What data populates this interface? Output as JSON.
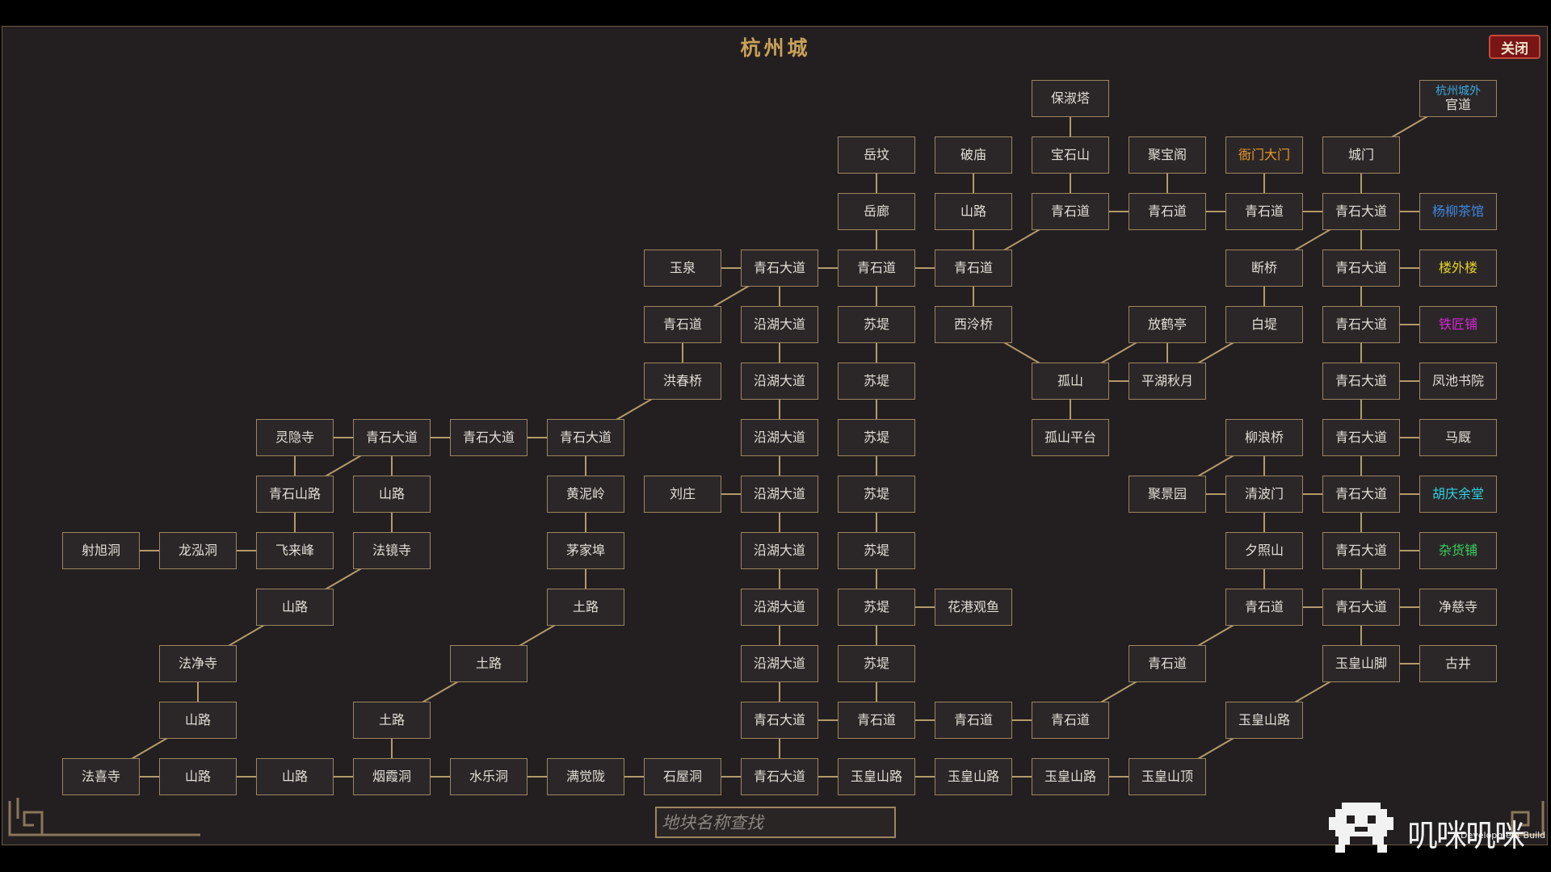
{
  "title": "杭州城",
  "close_label": "关闭",
  "search": {
    "placeholder": "地块名称查找"
  },
  "watermark": {
    "text": "叽咪叽咪",
    "build_label": "Development Build"
  },
  "colors": {
    "default": "#e2ddd5",
    "orange": "#e89a2a",
    "blue": "#3e86e0",
    "yellow": "#e3d12a",
    "magenta": "#d628d6",
    "cyan": "#2fd0e0",
    "green": "#3ad15e",
    "sky": "#3aa8e0"
  },
  "nodes": [
    {
      "id": "baoshuta",
      "label": "保淑塔"
    },
    {
      "id": "hzcw",
      "sub": "杭州城外",
      "label": "官道"
    },
    {
      "id": "yuefen",
      "label": "岳坟"
    },
    {
      "id": "pomiao",
      "label": "破庙"
    },
    {
      "id": "baoshishan",
      "label": "宝石山"
    },
    {
      "id": "jubaoge",
      "label": "聚宝阁"
    },
    {
      "id": "yamendamen",
      "label": "衙门大门",
      "color": "orange"
    },
    {
      "id": "chengmen",
      "label": "城门"
    },
    {
      "id": "yuelang",
      "label": "岳廊"
    },
    {
      "id": "shanlu_a",
      "label": "山路"
    },
    {
      "id": "qsd_a",
      "label": "青石道"
    },
    {
      "id": "qsd_b",
      "label": "青石道"
    },
    {
      "id": "qsd_c",
      "label": "青石道"
    },
    {
      "id": "qsdd_a",
      "label": "青石大道"
    },
    {
      "id": "yangliu",
      "label": "杨柳茶馆",
      "color": "blue"
    },
    {
      "id": "yuquan",
      "label": "玉泉"
    },
    {
      "id": "qsdd_b",
      "label": "青石大道"
    },
    {
      "id": "qsd_d",
      "label": "青石道"
    },
    {
      "id": "qsd_e",
      "label": "青石道"
    },
    {
      "id": "duanqiao",
      "label": "断桥"
    },
    {
      "id": "qsdd_c",
      "label": "青石大道"
    },
    {
      "id": "louwailou",
      "label": "楼外楼",
      "color": "yellow"
    },
    {
      "id": "qsd_f",
      "label": "青石道"
    },
    {
      "id": "yhdd_a",
      "label": "沿湖大道"
    },
    {
      "id": "sudi_a",
      "label": "苏堤"
    },
    {
      "id": "xilingqiao",
      "label": "西泠桥"
    },
    {
      "id": "fanghe",
      "label": "放鹤亭"
    },
    {
      "id": "baidi",
      "label": "白堤"
    },
    {
      "id": "qsdd_d",
      "label": "青石大道"
    },
    {
      "id": "tiejiang",
      "label": "铁匠铺",
      "color": "magenta"
    },
    {
      "id": "hongchun",
      "label": "洪春桥"
    },
    {
      "id": "yhdd_b",
      "label": "沿湖大道"
    },
    {
      "id": "sudi_b",
      "label": "苏堤"
    },
    {
      "id": "gushan",
      "label": "孤山"
    },
    {
      "id": "pinghu",
      "label": "平湖秋月"
    },
    {
      "id": "qsdd_e",
      "label": "青石大道"
    },
    {
      "id": "fengchi",
      "label": "凤池书院"
    },
    {
      "id": "lingyin",
      "label": "灵隐寺"
    },
    {
      "id": "qsdd_f",
      "label": "青石大道"
    },
    {
      "id": "qsdd_g",
      "label": "青石大道"
    },
    {
      "id": "qsdd_h",
      "label": "青石大道"
    },
    {
      "id": "yhdd_c",
      "label": "沿湖大道"
    },
    {
      "id": "sudi_c",
      "label": "苏堤"
    },
    {
      "id": "gushanpt",
      "label": "孤山平台"
    },
    {
      "id": "liulang",
      "label": "柳浪桥"
    },
    {
      "id": "qsdd_i",
      "label": "青石大道"
    },
    {
      "id": "majiu",
      "label": "马厩"
    },
    {
      "id": "qssl",
      "label": "青石山路"
    },
    {
      "id": "shanlu_b",
      "label": "山路"
    },
    {
      "id": "huangniling",
      "label": "黄泥岭"
    },
    {
      "id": "liuzhuang",
      "label": "刘庄"
    },
    {
      "id": "yhdd_d",
      "label": "沿湖大道"
    },
    {
      "id": "sudi_d",
      "label": "苏堤"
    },
    {
      "id": "jujingyuan",
      "label": "聚景园"
    },
    {
      "id": "qingbomen",
      "label": "清波门"
    },
    {
      "id": "qsdd_j",
      "label": "青石大道"
    },
    {
      "id": "huqingyu",
      "label": "胡庆余堂",
      "color": "cyan"
    },
    {
      "id": "shexu",
      "label": "射旭洞"
    },
    {
      "id": "longhong",
      "label": "龙泓洞"
    },
    {
      "id": "feilai",
      "label": "飞来峰"
    },
    {
      "id": "fajing",
      "label": "法镜寺"
    },
    {
      "id": "maojiabu",
      "label": "茅家埠"
    },
    {
      "id": "yhdd_e",
      "label": "沿湖大道"
    },
    {
      "id": "sudi_e",
      "label": "苏堤"
    },
    {
      "id": "xizhao",
      "label": "夕照山"
    },
    {
      "id": "qsdd_k",
      "label": "青石大道"
    },
    {
      "id": "zahuo",
      "label": "杂货铺",
      "color": "green"
    },
    {
      "id": "shanlu_c",
      "label": "山路"
    },
    {
      "id": "tulu_a",
      "label": "土路"
    },
    {
      "id": "yhdd_f",
      "label": "沿湖大道"
    },
    {
      "id": "sudi_f",
      "label": "苏堤"
    },
    {
      "id": "huagang",
      "label": "花港观鱼"
    },
    {
      "id": "qsd_g",
      "label": "青石道"
    },
    {
      "id": "qsdd_l",
      "label": "青石大道"
    },
    {
      "id": "jingci",
      "label": "净慈寺"
    },
    {
      "id": "fajingsi2",
      "label": "法净寺"
    },
    {
      "id": "tulu_b",
      "label": "土路"
    },
    {
      "id": "yhdd_g",
      "label": "沿湖大道"
    },
    {
      "id": "sudi_g",
      "label": "苏堤"
    },
    {
      "id": "qsd_h",
      "label": "青石道"
    },
    {
      "id": "yhsj",
      "label": "玉皇山脚"
    },
    {
      "id": "gujing",
      "label": "古井"
    },
    {
      "id": "shanlu_d",
      "label": "山路"
    },
    {
      "id": "tulu_c",
      "label": "土路"
    },
    {
      "id": "qsdd_m",
      "label": "青石大道"
    },
    {
      "id": "qsd_i",
      "label": "青石道"
    },
    {
      "id": "qsd_j",
      "label": "青石道"
    },
    {
      "id": "qsd_k",
      "label": "青石道"
    },
    {
      "id": "yhsl_a",
      "label": "玉皇山路"
    },
    {
      "id": "faxi",
      "label": "法喜寺"
    },
    {
      "id": "shanlu_e",
      "label": "山路"
    },
    {
      "id": "shanlu_f",
      "label": "山路"
    },
    {
      "id": "yanxia",
      "label": "烟霞洞"
    },
    {
      "id": "shuile",
      "label": "水乐洞"
    },
    {
      "id": "manjue",
      "label": "满觉陇"
    },
    {
      "id": "shiwu",
      "label": "石屋洞"
    },
    {
      "id": "qsdd_n",
      "label": "青石大道"
    },
    {
      "id": "yhsl_b",
      "label": "玉皇山路"
    },
    {
      "id": "yhsl_c",
      "label": "玉皇山路"
    },
    {
      "id": "yhsl_d",
      "label": "玉皇山路"
    },
    {
      "id": "yhsd",
      "label": "玉皇山顶"
    }
  ],
  "edges": [
    [
      "baoshuta",
      "baoshishan"
    ],
    [
      "hzcw",
      "chengmen"
    ],
    [
      "yuefen",
      "yuelang"
    ],
    [
      "pomiao",
      "shanlu_a"
    ],
    [
      "baoshishan",
      "qsd_a"
    ],
    [
      "jubaoge",
      "qsd_b"
    ],
    [
      "yamendamen",
      "qsd_c"
    ],
    [
      "chengmen",
      "qsdd_a"
    ],
    [
      "qsd_a",
      "qsd_b"
    ],
    [
      "qsd_b",
      "qsd_c"
    ],
    [
      "qsd_c",
      "qsdd_a"
    ],
    [
      "qsdd_a",
      "yangliu"
    ],
    [
      "yuelang",
      "qsd_d"
    ],
    [
      "shanlu_a",
      "qsd_e"
    ],
    [
      "qsd_a",
      "qsd_e"
    ],
    [
      "yuquan",
      "qsdd_b"
    ],
    [
      "qsdd_b",
      "qsd_d"
    ],
    [
      "qsd_d",
      "qsd_e"
    ],
    [
      "qsdd_a",
      "duanqiao"
    ],
    [
      "qsdd_a",
      "qsdd_c"
    ],
    [
      "qsdd_c",
      "louwailou"
    ],
    [
      "qsdd_b",
      "qsd_f"
    ],
    [
      "qsdd_b",
      "yhdd_a"
    ],
    [
      "qsd_d",
      "sudi_a"
    ],
    [
      "qsd_e",
      "xilingqiao"
    ],
    [
      "duanqiao",
      "baidi"
    ],
    [
      "qsdd_c",
      "qsdd_d"
    ],
    [
      "qsdd_d",
      "tiejiang"
    ],
    [
      "qsd_f",
      "hongchun"
    ],
    [
      "yhdd_a",
      "yhdd_b"
    ],
    [
      "sudi_a",
      "sudi_b"
    ],
    [
      "xilingqiao",
      "gushan"
    ],
    [
      "fanghe",
      "gushan"
    ],
    [
      "gushan",
      "pinghu"
    ],
    [
      "pinghu",
      "baidi"
    ],
    [
      "fanghe",
      "pinghu"
    ],
    [
      "qsdd_d",
      "qsdd_e"
    ],
    [
      "qsdd_e",
      "fengchi"
    ],
    [
      "hongchun",
      "qsdd_h"
    ],
    [
      "lingyin",
      "qsdd_f"
    ],
    [
      "qsdd_f",
      "qsdd_g"
    ],
    [
      "qsdd_g",
      "qsdd_h"
    ],
    [
      "yhdd_b",
      "yhdd_c"
    ],
    [
      "sudi_b",
      "sudi_c"
    ],
    [
      "gushan",
      "gushanpt"
    ],
    [
      "qsdd_e",
      "qsdd_i"
    ],
    [
      "qsdd_i",
      "majiu"
    ],
    [
      "lingyin",
      "qssl"
    ],
    [
      "qsdd_f",
      "qssl"
    ],
    [
      "qsdd_f",
      "shanlu_b"
    ],
    [
      "qsdd_h",
      "huangniling"
    ],
    [
      "liuzhuang",
      "yhdd_d"
    ],
    [
      "yhdd_c",
      "yhdd_d"
    ],
    [
      "sudi_c",
      "sudi_d"
    ],
    [
      "jujingyuan",
      "qingbomen"
    ],
    [
      "liulang",
      "jujingyuan"
    ],
    [
      "liulang",
      "qingbomen"
    ],
    [
      "qingbomen",
      "qsdd_j"
    ],
    [
      "qsdd_i",
      "qsdd_j"
    ],
    [
      "qsdd_j",
      "huqingyu"
    ],
    [
      "shexu",
      "longhong"
    ],
    [
      "longhong",
      "feilai"
    ],
    [
      "qssl",
      "feilai"
    ],
    [
      "shanlu_b",
      "fajing"
    ],
    [
      "huangniling",
      "maojiabu"
    ],
    [
      "yhdd_d",
      "yhdd_e"
    ],
    [
      "sudi_d",
      "sudi_e"
    ],
    [
      "qingbomen",
      "xizhao"
    ],
    [
      "qsdd_j",
      "qsdd_k"
    ],
    [
      "qsdd_k",
      "zahuo"
    ],
    [
      "fajing",
      "shanlu_c"
    ],
    [
      "maojiabu",
      "tulu_a"
    ],
    [
      "yhdd_e",
      "yhdd_f"
    ],
    [
      "sudi_e",
      "sudi_f"
    ],
    [
      "sudi_f",
      "huagang"
    ],
    [
      "xizhao",
      "qsd_g"
    ],
    [
      "qsd_g",
      "qsdd_l"
    ],
    [
      "qsdd_k",
      "qsdd_l"
    ],
    [
      "qsdd_l",
      "jingci"
    ],
    [
      "shanlu_c",
      "fajingsi2"
    ],
    [
      "tulu_a",
      "tulu_b"
    ],
    [
      "yhdd_f",
      "yhdd_g"
    ],
    [
      "sudi_f",
      "sudi_g"
    ],
    [
      "qsd_g",
      "qsd_h"
    ],
    [
      "qsdd_l",
      "yhsj"
    ],
    [
      "yhsj",
      "gujing"
    ],
    [
      "fajingsi2",
      "shanlu_d"
    ],
    [
      "tulu_b",
      "tulu_c"
    ],
    [
      "yhdd_g",
      "qsdd_m"
    ],
    [
      "sudi_g",
      "qsd_i"
    ],
    [
      "qsdd_m",
      "qsd_i"
    ],
    [
      "qsd_i",
      "qsd_j"
    ],
    [
      "qsd_j",
      "qsd_k"
    ],
    [
      "qsd_h",
      "qsd_k"
    ],
    [
      "yhsj",
      "yhsl_a"
    ],
    [
      "shanlu_d",
      "faxi"
    ],
    [
      "faxi",
      "shanlu_e"
    ],
    [
      "shanlu_e",
      "shanlu_f"
    ],
    [
      "shanlu_f",
      "yanxia"
    ],
    [
      "tulu_c",
      "yanxia"
    ],
    [
      "yanxia",
      "shuile"
    ],
    [
      "shuile",
      "manjue"
    ],
    [
      "manjue",
      "shiwu"
    ],
    [
      "shiwu",
      "qsdd_n"
    ],
    [
      "qsdd_m",
      "qsdd_n"
    ],
    [
      "qsdd_n",
      "yhsl_b"
    ],
    [
      "yhsl_b",
      "yhsl_c"
    ],
    [
      "yhsl_c",
      "yhsl_d"
    ],
    [
      "yhsl_d",
      "yhsd"
    ],
    [
      "yhsl_a",
      "yhsd"
    ]
  ]
}
